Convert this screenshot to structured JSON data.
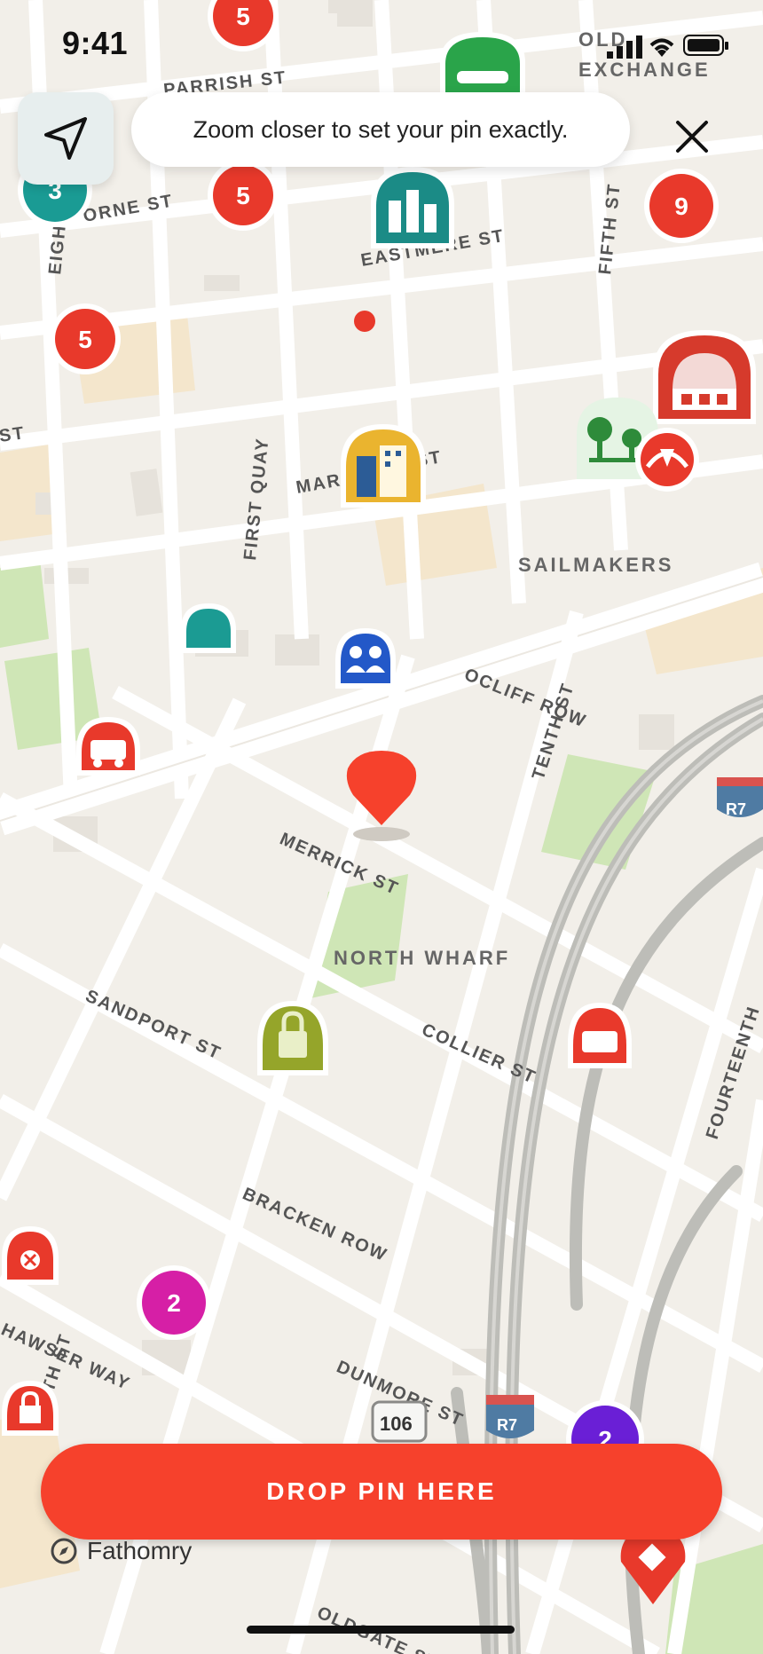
{
  "status_bar": {
    "time": "9:41"
  },
  "toast": {
    "message": "Zoom closer to set your pin exactly."
  },
  "map": {
    "streets": [
      "PARRISH ST",
      "EIGHT",
      "ORNE ST",
      "EASTMERE ST",
      "FIFTH ST",
      "ST",
      "MARC",
      "ST",
      "FIRST QUAY",
      "OCLIFF ROW",
      "TENTH ST",
      "MERRICK ST",
      "SANDPORT ST",
      "COLLIER ST",
      "FOURTEENTH",
      "BRACKEN ROW",
      "HAWSER WAY",
      "ENTH ST",
      "DUNMORE ST",
      "OLDGATE ST"
    ],
    "districts": [
      "OLD",
      "EXCHANGE",
      "SAILMAKERS",
      "NORTH WHARF"
    ],
    "route_shields": [
      "R7",
      "R7"
    ],
    "road_number": "106",
    "cluster_counts": [
      "5",
      "3",
      "5",
      "5",
      "9",
      "2",
      "2"
    ]
  },
  "bottom": {
    "action_label": "DROP PIN HERE",
    "brand": "Fathomry"
  },
  "colors": {
    "accent": "#f6412c",
    "map_bg": "#f2efe9",
    "road": "#ffffff",
    "park": "#cfe6b6",
    "sand": "#f4e6cc"
  }
}
